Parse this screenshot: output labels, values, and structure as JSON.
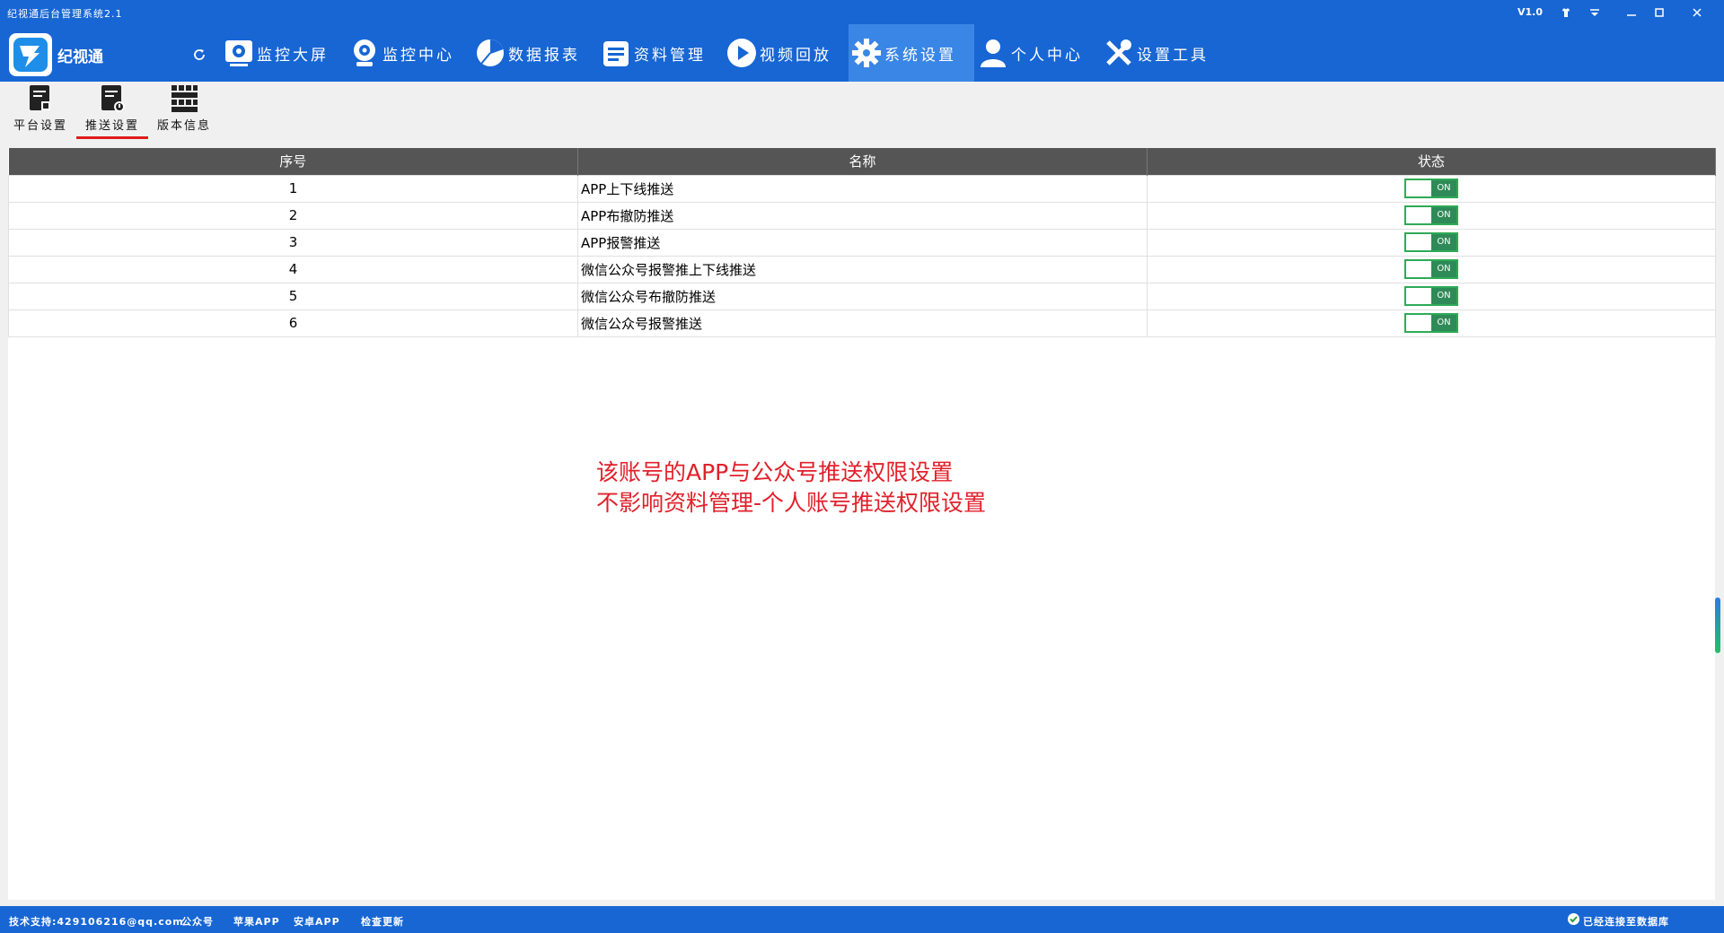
{
  "titlebar": {
    "title": "纪视通后台管理系统2.1",
    "version": "V1.0"
  },
  "nav": {
    "logo_text": "纪视通",
    "items": [
      {
        "label": "监控大屏",
        "icon": "monitor-screen-icon"
      },
      {
        "label": "监控中心",
        "icon": "camera-icon"
      },
      {
        "label": "数据报表",
        "icon": "pie-chart-icon"
      },
      {
        "label": "资料管理",
        "icon": "document-icon"
      },
      {
        "label": "视频回放",
        "icon": "play-icon"
      },
      {
        "label": "系统设置",
        "icon": "gear-icon",
        "active": true
      },
      {
        "label": "个人中心",
        "icon": "user-icon"
      },
      {
        "label": "设置工具",
        "icon": "tools-icon"
      }
    ]
  },
  "subnav": {
    "items": [
      {
        "label": "平台设置",
        "icon": "platform-settings-icon"
      },
      {
        "label": "推送设置",
        "icon": "push-settings-icon",
        "active": true
      },
      {
        "label": "版本信息",
        "icon": "version-info-icon"
      }
    ]
  },
  "table": {
    "headers": [
      "序号",
      "名称",
      "状态"
    ],
    "rows": [
      {
        "num": "1",
        "name": "APP上下线推送",
        "state": "ON"
      },
      {
        "num": "2",
        "name": "APP布撤防推送",
        "state": "ON"
      },
      {
        "num": "3",
        "name": "APP报警推送",
        "state": "ON"
      },
      {
        "num": "4",
        "name": "微信公众号报警推上下线推送",
        "state": "ON"
      },
      {
        "num": "5",
        "name": "微信公众号布撤防推送",
        "state": "ON"
      },
      {
        "num": "6",
        "name": "微信公众号报警推送",
        "state": "ON"
      }
    ]
  },
  "annotation": {
    "line1": "该账号的APP与公众号推送权限设置",
    "line2": "不影响资料管理-个人账号推送权限设置"
  },
  "statusbar": {
    "support": "技术支持:429106216@qq.com",
    "wechat": "公众号",
    "apple": "苹果APP",
    "android": "安卓APP",
    "update": "检查更新",
    "connection": "已经连接至数据库"
  },
  "colors": {
    "primary": "#1766d4",
    "active_nav": "#3a86e6",
    "toggle_on": "#2e8b57",
    "annotation": "#e0202a",
    "tab_underline": "#e01b1b"
  }
}
